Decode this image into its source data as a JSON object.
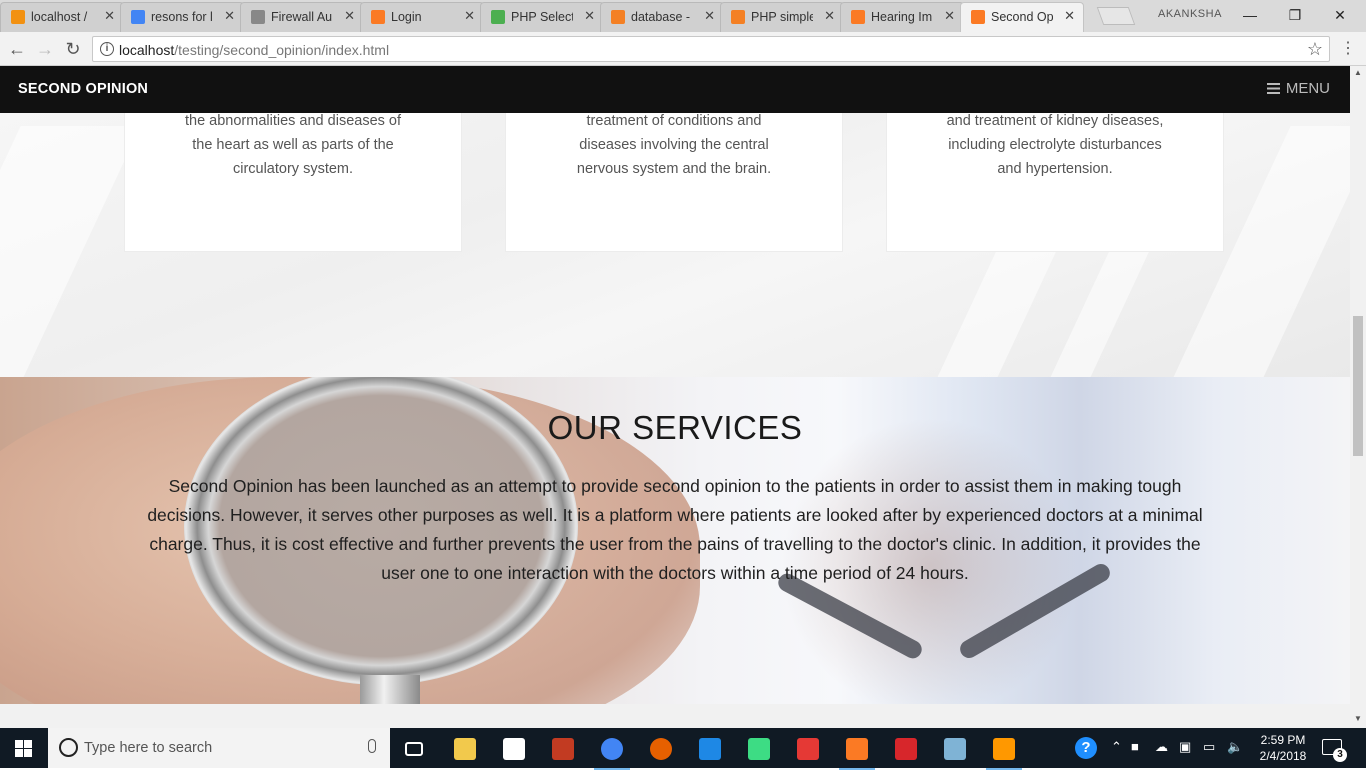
{
  "browser": {
    "tabs": [
      {
        "title": "localhost /",
        "icon": "phpmyadmin-icon",
        "color": "#f29111"
      },
      {
        "title": "resons for l",
        "icon": "google-icon",
        "color": "#4285f4"
      },
      {
        "title": "Firewall Au",
        "icon": "document-icon",
        "color": "#888888"
      },
      {
        "title": "Login",
        "icon": "xampp-icon",
        "color": "#fb7a24"
      },
      {
        "title": "PHP Select",
        "icon": "w3schools-icon",
        "color": "#4caf50"
      },
      {
        "title": "database -",
        "icon": "stackoverflow-icon",
        "color": "#f48024"
      },
      {
        "title": "PHP simple",
        "icon": "stackoverflow-icon",
        "color": "#f48024"
      },
      {
        "title": "Hearing Im",
        "icon": "xampp-icon",
        "color": "#fb7a24"
      },
      {
        "title": "Second Op",
        "icon": "xampp-icon",
        "color": "#fb7a24",
        "active": true
      }
    ],
    "profile_name": "AKANKSHA",
    "url_host": "localhost",
    "url_path": "/testing/second_opinion/index.html"
  },
  "site": {
    "brand": "SECOND OPINION",
    "menu_label": "MENU",
    "cards": [
      {
        "lines": [
          "the abnormalities and diseases of",
          "the heart as well as parts of the",
          "circulatory system."
        ]
      },
      {
        "lines": [
          "treatment of conditions and",
          "diseases involving the central",
          "nervous system and the brain."
        ]
      },
      {
        "lines": [
          "and treatment of kidney diseases,",
          "including electrolyte disturbances",
          "and hypertension."
        ]
      }
    ],
    "services": {
      "title": "OUR SERVICES",
      "text": "Second Opinion has been launched as an attempt to provide second opinion to the patients in order to assist them in making tough decisions. However, it serves other purposes as well. It is a platform where patients are looked after by experienced doctors at a minimal charge. Thus, it is cost effective and further prevents the user from the pains of travelling to the doctor's clinic. In addition, it provides the user one to one interaction with the doctors within a time period of 24 hours."
    }
  },
  "taskbar": {
    "search_placeholder": "Type here to search",
    "apps": [
      {
        "name": "task-view-icon",
        "color": "#101a24"
      },
      {
        "name": "file-explorer-icon",
        "color": "#f2c94c"
      },
      {
        "name": "store-icon",
        "color": "#ffffff"
      },
      {
        "name": "app-icon",
        "color": "#c23b22"
      },
      {
        "name": "chrome-icon",
        "color": "#4285f4",
        "running": true
      },
      {
        "name": "firefox-icon",
        "color": "#e66000"
      },
      {
        "name": "app-icon",
        "color": "#1e88e5"
      },
      {
        "name": "android-studio-icon",
        "color": "#3ddc84"
      },
      {
        "name": "app-icon",
        "color": "#e53935"
      },
      {
        "name": "xampp-icon",
        "color": "#fb7a24",
        "running": true
      },
      {
        "name": "acrobat-icon",
        "color": "#d7262b"
      },
      {
        "name": "app-icon",
        "color": "#7fb3d5"
      },
      {
        "name": "sublime-text-icon",
        "color": "#ff9800",
        "running": true
      }
    ],
    "time": "2:59 PM",
    "date": "2/4/2018",
    "notification_count": "3"
  }
}
